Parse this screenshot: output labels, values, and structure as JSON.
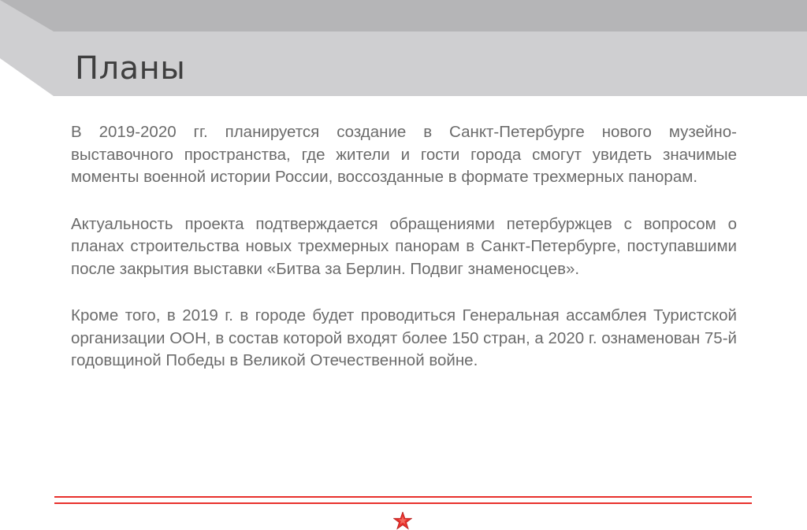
{
  "slide": {
    "title": "Планы",
    "paragraphs": [
      "В 2019-2020 гг. планируется создание в Санкт-Петербурге нового музейно-выставочного пространства, где жители и гости города смогут увидеть значимые моменты военной истории России, воссозданные в формате трехмерных панорам.",
      "Актуальность проекта подтверждается обращениями петербуржцев с вопросом о планах строительства новых трехмерных панорам в Санкт-Петербурге, поступавшими после закрытия выставки «Битва за Берлин. Подвиг знаменосцев».",
      "Кроме того, в 2019 г. в городе будет проводиться Генеральная ассамблея Туристской организации ООН, в состав которой входят более 150 стран, а 2020 г. ознаменован 75-й годовщиной Победы в Великой Отечественной войне."
    ]
  },
  "colors": {
    "header_dark": "#b5b5b7",
    "header_light": "#cfcfd1",
    "accent_red": "#e8302c",
    "title_text": "#3f3f3f",
    "body_text": "#6b6b6b"
  },
  "icons": {
    "footer": "red-star-icon"
  }
}
